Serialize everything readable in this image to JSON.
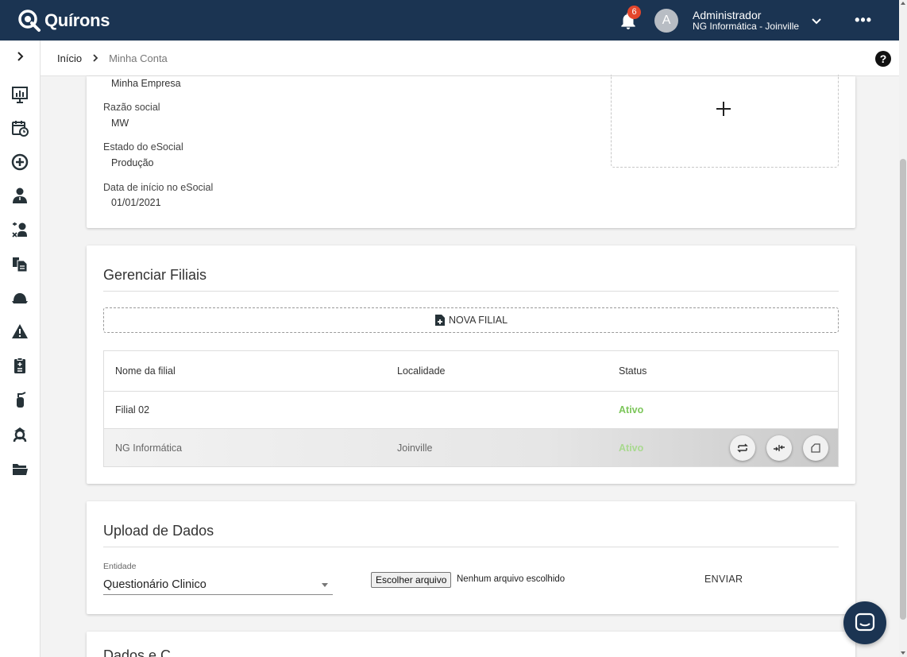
{
  "header": {
    "brand": "Quírons",
    "notification_count": "6",
    "avatar_initial": "A",
    "user_name": "Administrador",
    "user_org": "NG Informática - Joinville",
    "more_label": "•••"
  },
  "breadcrumb": {
    "home": "Início",
    "current": "Minha Conta"
  },
  "help_label": "?",
  "company": {
    "name_value": "Minha Empresa",
    "razao_label": "Razão social",
    "razao_value": "MW",
    "esocial_state_label": "Estado do eSocial",
    "esocial_state_value": "Produção",
    "esocial_start_label": "Data de início no eSocial",
    "esocial_start_value": "01/01/2021"
  },
  "branches": {
    "title": "Gerenciar Filiais",
    "new_button": "NOVA FILIAL",
    "columns": [
      "Nome da filial",
      "Localidade",
      "Status"
    ],
    "rows": [
      {
        "name": "Filial 02",
        "location": "",
        "status": "Ativo"
      },
      {
        "name": "NG Informática",
        "location": "Joinville",
        "status": "Ativo"
      }
    ]
  },
  "upload": {
    "title": "Upload de Dados",
    "entity_label": "Entidade",
    "entity_value": "Questionário Clinico",
    "file_button": "Escolher arquivo",
    "file_status": "Nenhum arquivo escolhido",
    "send_button": "ENVIAR"
  },
  "next_section_title": "Dados e C...",
  "colors": {
    "topbar": "#1b3452",
    "status_active": "#7cc65a",
    "badge": "#e4462c"
  }
}
